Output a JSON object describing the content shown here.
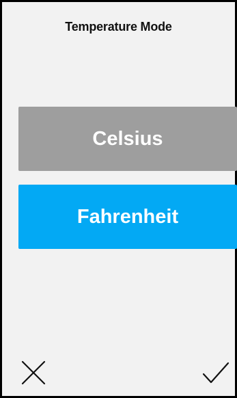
{
  "header": {
    "title": "Temperature Mode"
  },
  "options": [
    {
      "label": "Celsius",
      "selected": false,
      "color": "#9e9e9e"
    },
    {
      "label": "Fahrenheit",
      "selected": true,
      "color": "#03a9f4"
    }
  ],
  "footer": {
    "cancel_icon": "close-icon",
    "confirm_icon": "check-icon"
  },
  "colors": {
    "background": "#f2f2f2",
    "selected": "#03a9f4",
    "unselected": "#9e9e9e"
  }
}
